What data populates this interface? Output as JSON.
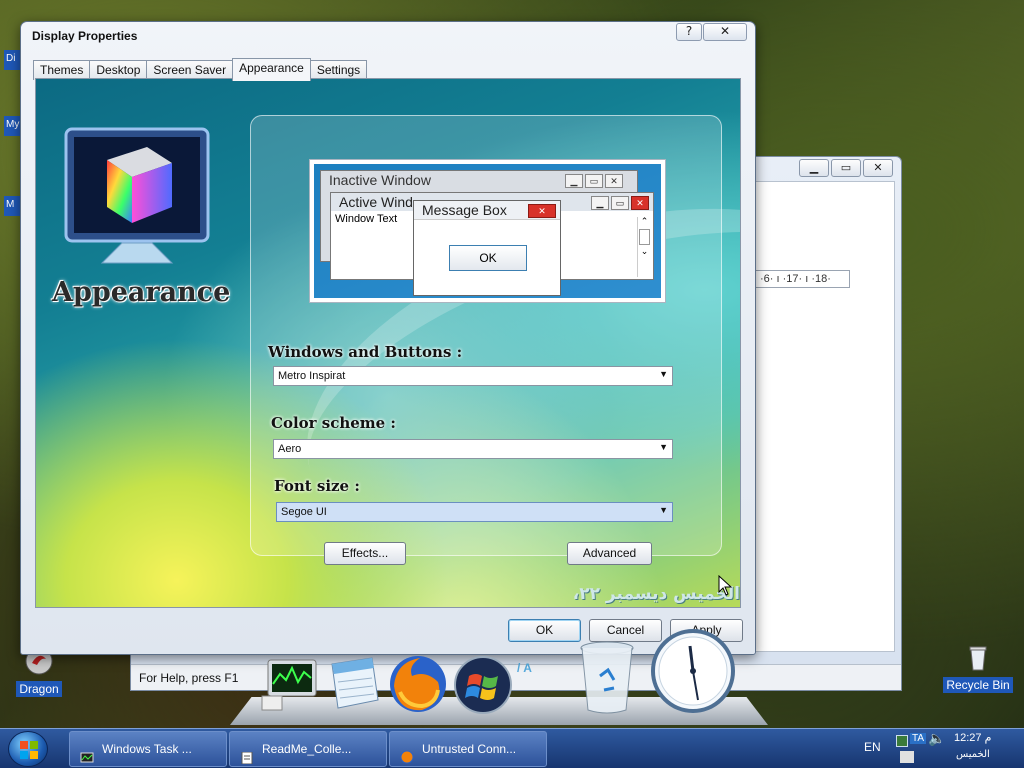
{
  "desktop": {
    "icons": [
      {
        "label": "Dragon",
        "icon": "dragon-icon"
      },
      {
        "label": "Recycle Bin",
        "icon": "recycle-bin-icon"
      }
    ],
    "left_tabs": [
      "Di",
      "My",
      "M",
      "",
      "",
      "",
      "",
      ""
    ]
  },
  "background_window": {
    "ruler_text": "·6· ı ·17· ı ·18·",
    "status_text": "For Help, press F1",
    "status_fragment": "‭/ A",
    "buttons": {
      "minimize": "▁",
      "maximize": "▭",
      "close": "✕"
    }
  },
  "dialog": {
    "title": "Display Properties",
    "title_buttons": {
      "help": "?",
      "close": "✕"
    },
    "tabs": [
      "Themes",
      "Desktop",
      "Screen Saver",
      "Appearance",
      "Settings"
    ],
    "active_tab": "Appearance",
    "header_label": "Appearance",
    "preview": {
      "inactive_title": "Inactive Window",
      "active_title": "Active Wind",
      "window_text": "Window Text",
      "message_title": "Message Box",
      "ok": "OK"
    },
    "windows_buttons": {
      "label": "Windows and Buttons :",
      "value": "Metro Inspirat"
    },
    "color_scheme": {
      "label": "Color scheme :",
      "value": "Aero"
    },
    "font_size": {
      "label": "Font size :",
      "value": "Segoe UI"
    },
    "effects_button": "Effects...",
    "advanced_button": "Advanced",
    "date_overlay": "الخميس ديسمبر ٢٢، ٢٠٢٢",
    "ok": "OK",
    "cancel": "Cancel",
    "apply": "Apply"
  },
  "taskbar": {
    "tasks": [
      "Windows Task ...",
      "ReadMe_Colle...",
      "Untrusted Conn..."
    ],
    "lang": "EN",
    "time": "12:27 م",
    "day": "الخميس",
    "tray_badge": "TA"
  },
  "colors": {
    "accent": "#1f58b8",
    "taskbar": "#2f5aa0",
    "close_red": "#d8322a"
  }
}
